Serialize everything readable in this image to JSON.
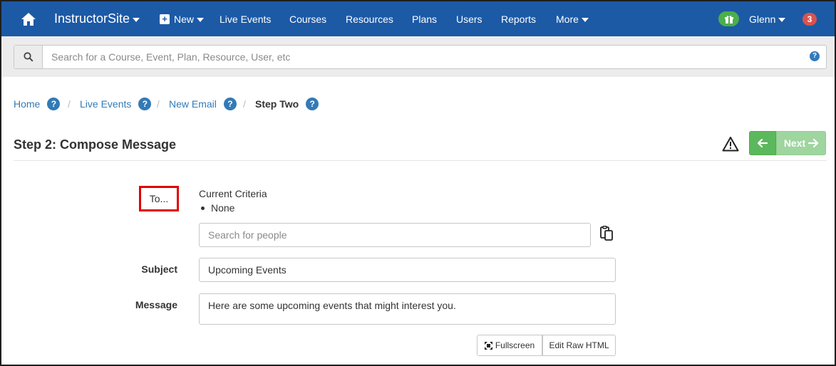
{
  "navbar": {
    "brand": "InstructorSite",
    "new_label": "New",
    "items": [
      "Live Events",
      "Courses",
      "Resources",
      "Plans",
      "Users",
      "Reports"
    ],
    "more_label": "More",
    "user_name": "Glenn",
    "notification_count": "3",
    "bg_color": "#1c5aa6"
  },
  "search": {
    "placeholder": "Search for a Course, Event, Plan, Resource, User, etc",
    "help_glyph": "?"
  },
  "breadcrumb": {
    "items": [
      "Home",
      "Live Events",
      "New Email"
    ],
    "active": "Step Two",
    "help_glyph": "?",
    "separator": "/"
  },
  "page": {
    "title": "Step 2: Compose Message",
    "next_label": "Next"
  },
  "form": {
    "to_label": "To...",
    "criteria_title": "Current Criteria",
    "criteria_items": [
      "None"
    ],
    "people_placeholder": "Search for people",
    "subject_label": "Subject",
    "subject_value": "Upcoming Events",
    "message_label": "Message",
    "message_value": "Here are some upcoming events that might interest you.",
    "fullscreen_label": "Fullscreen",
    "raw_html_label": "Edit Raw HTML"
  }
}
